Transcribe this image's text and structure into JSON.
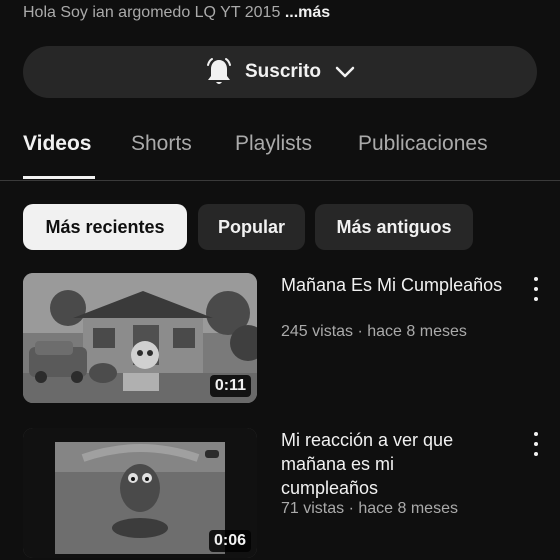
{
  "channel": {
    "description": "Hola Soy ian argomedo LQ YT 2015",
    "more_label": "...más"
  },
  "subscribe": {
    "label": "Suscrito",
    "bell_icon": "bell-icon",
    "chevron_icon": "chevron-down-icon"
  },
  "tabs": [
    {
      "label": "Videos",
      "active": true
    },
    {
      "label": "Shorts",
      "active": false
    },
    {
      "label": "Playlists",
      "active": false
    },
    {
      "label": "Publicaciones",
      "active": false
    }
  ],
  "filters": [
    {
      "label": "Más recientes",
      "selected": true
    },
    {
      "label": "Popular",
      "selected": false
    },
    {
      "label": "Más antiguos",
      "selected": false
    }
  ],
  "videos": [
    {
      "title": "Mañana Es Mi Cumpleaños",
      "meta": "245 vistas · hace 8 meses",
      "duration": "0:11"
    },
    {
      "title": "Mi reacción a ver que mañana es mi cumpleaños",
      "meta": "71 vistas · hace 8 meses",
      "duration": "0:06"
    }
  ],
  "colors": {
    "background": "#0f0f0f",
    "chip_selected": "#f1f1f1",
    "chip_default": "#272727",
    "text_secondary": "#aaaaaa"
  }
}
